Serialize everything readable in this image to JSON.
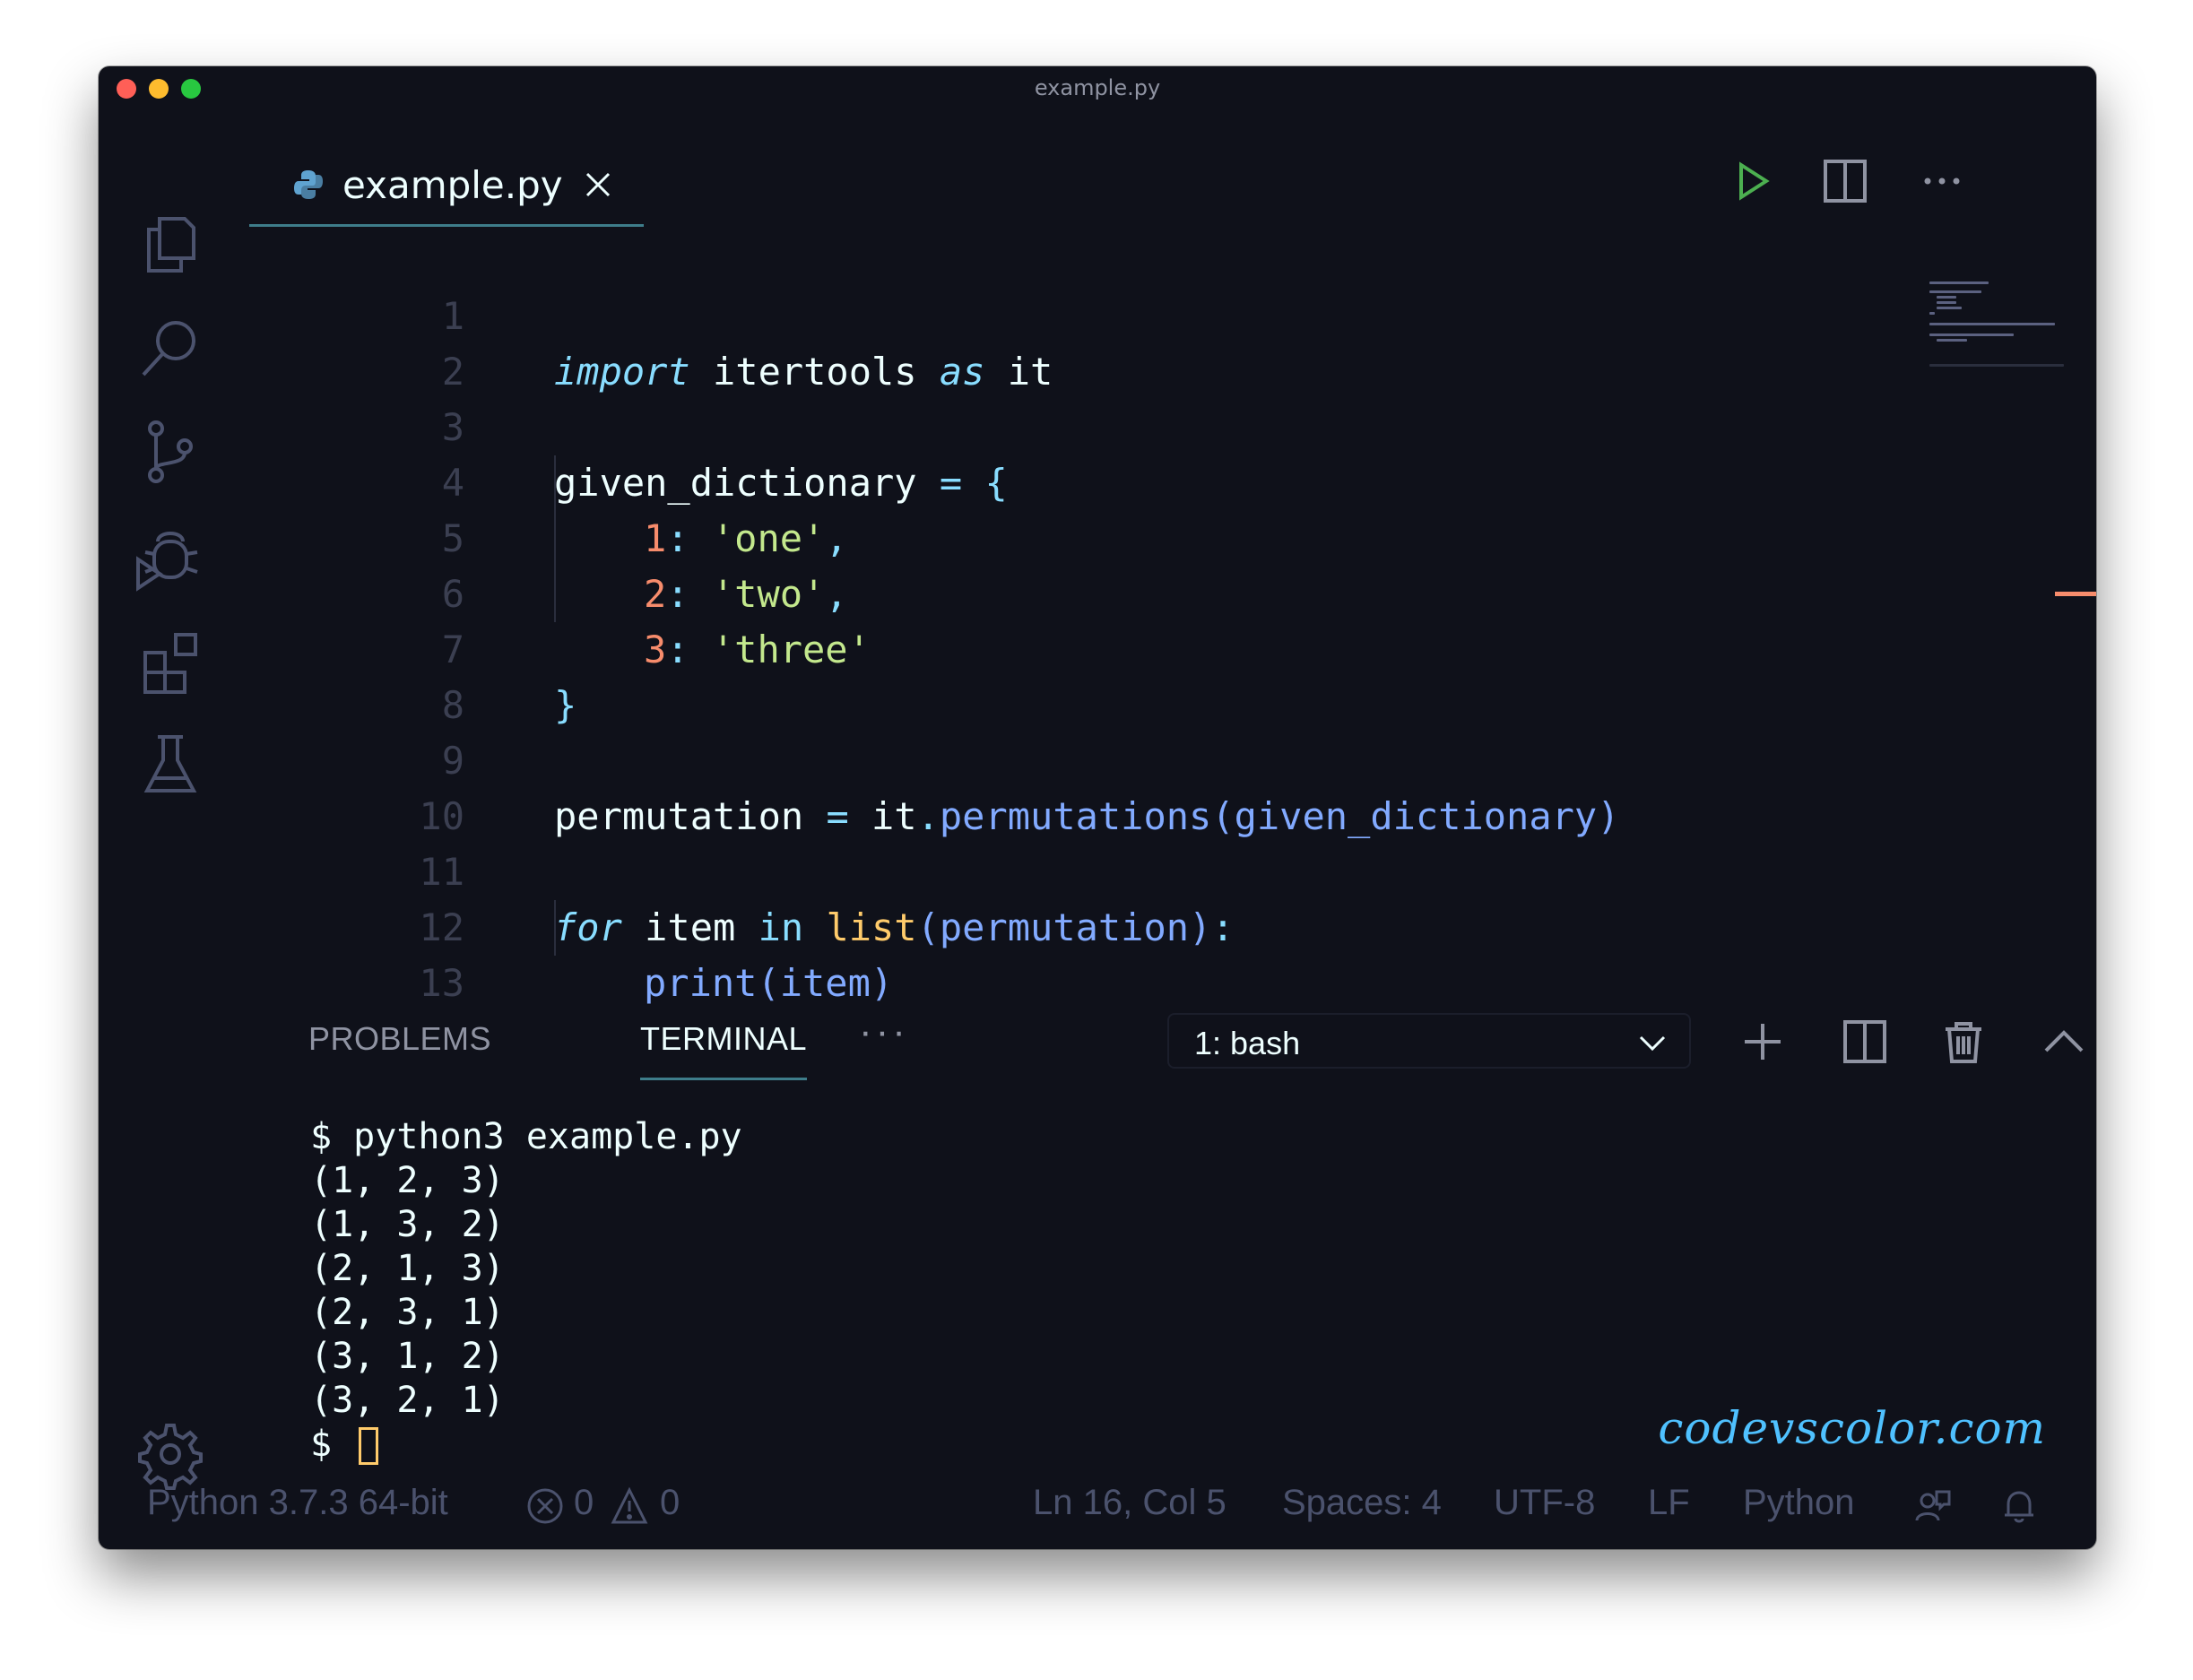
{
  "window": {
    "title": "example.py"
  },
  "tab": {
    "label": "example.py"
  },
  "code": {
    "line_numbers": [
      "1",
      "2",
      "3",
      "4",
      "5",
      "6",
      "7",
      "8",
      "9",
      "10",
      "11",
      "12",
      "13"
    ],
    "line1": {
      "kw1": "import",
      "mod": " itertools ",
      "kw2": "as",
      "alias": " it"
    },
    "line3": {
      "name": "given_dictionary",
      "eq": " = ",
      "brace": "{"
    },
    "line4": {
      "key": "1",
      "colon": ": ",
      "val": "'one'",
      "comma": ","
    },
    "line5": {
      "key": "2",
      "colon": ": ",
      "val": "'two'",
      "comma": ","
    },
    "line6": {
      "key": "3",
      "colon": ": ",
      "val": "'three'"
    },
    "line7": {
      "brace": "}"
    },
    "line9": {
      "name": "permutation",
      "eq": " = ",
      "obj": "it",
      "dot": ".",
      "fn": "permutations",
      "args": "(given_dictionary)"
    },
    "line11": {
      "kw1": "for",
      "var": " item ",
      "kw2": "in",
      "sp": " ",
      "bi": "list",
      "args": "(permutation)",
      "colon": ":"
    },
    "line12": {
      "fn": "print",
      "args": "(item)"
    }
  },
  "panel": {
    "tabs": {
      "problems": "PROBLEMS",
      "terminal": "TERMINAL",
      "more": "···"
    },
    "shell": "1: bash"
  },
  "terminal": {
    "lines": [
      "$ python3 example.py",
      "(1, 2, 3)",
      "(1, 3, 2)",
      "(2, 1, 3)",
      "(2, 3, 1)",
      "(3, 1, 2)",
      "(3, 2, 1)"
    ],
    "prompt": "$"
  },
  "watermark": "codevscolor.com",
  "statusbar": {
    "interpreter": "Python 3.7.3 64-bit",
    "errors": "0",
    "warnings": "0",
    "position": "Ln 16, Col 5",
    "spaces": "Spaces: 4",
    "encoding": "UTF-8",
    "eol": "LF",
    "language": "Python"
  },
  "colors": {
    "background": "#0f111a",
    "keyword": "#89ddff",
    "string": "#c3e88d",
    "number": "#f78c6c",
    "function": "#82aaff",
    "builtin": "#ffcb6b",
    "run_button": "#4caf50"
  },
  "icons": {
    "activity_bar": [
      "files-icon",
      "search-icon",
      "source-control-icon",
      "debug-icon",
      "extensions-icon",
      "testing-icon",
      "gear-icon"
    ],
    "editor_actions": [
      "run-icon",
      "split-editor-icon",
      "more-icon"
    ],
    "panel_actions": [
      "add-terminal-icon",
      "split-terminal-icon",
      "trash-icon",
      "maximize-panel-icon",
      "close-panel-icon"
    ]
  }
}
